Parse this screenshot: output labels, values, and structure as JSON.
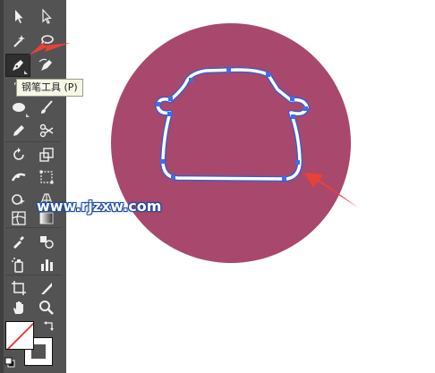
{
  "tooltip": {
    "label": "钢笔工具 (P)"
  },
  "watermark": {
    "text": "www.rjzxw.com"
  },
  "colors": {
    "toolbar_bg": "#535353",
    "circle_fill": "#a8486c",
    "path_stroke": "#ffffff",
    "path_outline": "#2b5fd9",
    "anchor_points": "#3d6ef0",
    "arrow": "#e8413a",
    "watermark_outline": "#1d4aa8"
  },
  "tools": [
    {
      "name": "selection-tool",
      "icon": "arrow-icon"
    },
    {
      "name": "direct-selection-tool",
      "icon": "white-arrow-icon"
    },
    {
      "name": "magic-wand-tool",
      "icon": "magic-wand-icon"
    },
    {
      "name": "lasso-tool",
      "icon": "lasso-icon"
    },
    {
      "name": "pen-tool",
      "icon": "pen-icon",
      "active": true
    },
    {
      "name": "curvature-tool",
      "icon": "curvature-pen-icon"
    },
    {
      "name": "ellipse-tool",
      "icon": "ellipse-icon"
    },
    {
      "name": "paintbrush-tool",
      "icon": "paintbrush-icon"
    },
    {
      "name": "pencil-tool",
      "icon": "pencil-icon"
    },
    {
      "name": "scissors-tool",
      "icon": "scissors-icon"
    },
    {
      "name": "rotate-tool",
      "icon": "rotate-icon"
    },
    {
      "name": "scale-tool",
      "icon": "scale-icon"
    },
    {
      "name": "width-tool",
      "icon": "width-icon"
    },
    {
      "name": "free-transform-tool",
      "icon": "free-transform-icon"
    },
    {
      "name": "shape-builder-tool",
      "icon": "shape-builder-icon"
    },
    {
      "name": "perspective-grid-tool",
      "icon": "perspective-grid-icon"
    },
    {
      "name": "mesh-tool",
      "icon": "mesh-icon"
    },
    {
      "name": "gradient-tool",
      "icon": "gradient-icon"
    },
    {
      "name": "eyedropper-tool",
      "icon": "eyedropper-icon"
    },
    {
      "name": "blend-tool",
      "icon": "blend-icon"
    },
    {
      "name": "symbol-sprayer-tool",
      "icon": "symbol-sprayer-icon"
    },
    {
      "name": "column-graph-tool",
      "icon": "column-graph-icon"
    },
    {
      "name": "artboard-tool",
      "icon": "artboard-icon"
    },
    {
      "name": "slice-tool",
      "icon": "slice-icon"
    },
    {
      "name": "hand-tool",
      "icon": "hand-icon"
    },
    {
      "name": "zoom-tool",
      "icon": "zoom-icon"
    }
  ]
}
